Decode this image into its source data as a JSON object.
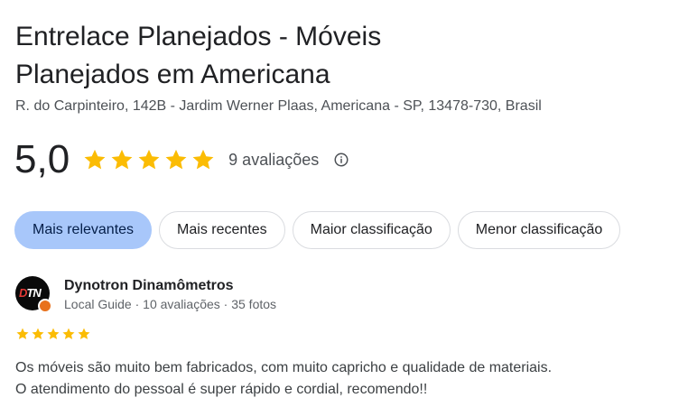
{
  "place": {
    "title_line1": "Entrelace Planejados - Móveis",
    "title_line2": "Planejados em Americana",
    "address": "R. do Carpinteiro, 142B - Jardim Werner Plaas, Americana - SP, 13478-730, Brasil"
  },
  "rating": {
    "value": "5,0",
    "stars": 5,
    "review_count": "9 avaliações",
    "info_icon": "info-icon",
    "star_color": "#fbbc04"
  },
  "sort_chips": [
    {
      "label": "Mais relevantes",
      "active": true
    },
    {
      "label": "Mais recentes",
      "active": false
    },
    {
      "label": "Maior classificação",
      "active": false
    },
    {
      "label": "Menor classificação",
      "active": false
    }
  ],
  "review": {
    "avatar_text_1": "D",
    "avatar_text_2": "TN",
    "reviewer_name": "Dynotron Dinamômetros",
    "reviewer_meta": "Local Guide · 10 avaliações · 35 fotos",
    "stars": 5,
    "text_line1": "Os móveis são muito bem fabricados, com muito capricho e qualidade de materiais.",
    "text_line2": "O atendimento do pessoal é super rápido e cordial, recomendo!!"
  },
  "colors": {
    "active_chip": "#a8c7fa",
    "guide_badge": "#e8711c"
  }
}
